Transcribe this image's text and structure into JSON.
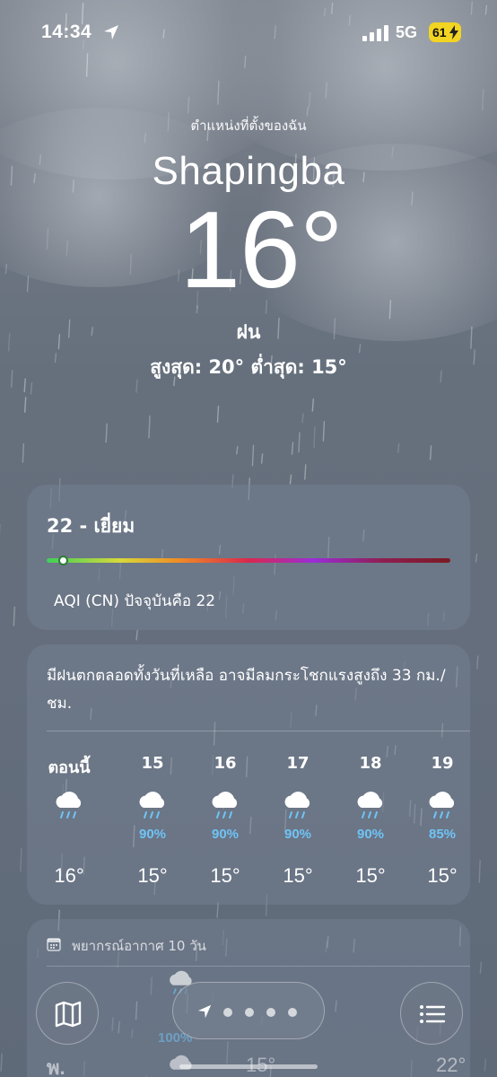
{
  "status_bar": {
    "time": "14:34",
    "network": "5G",
    "battery": "61"
  },
  "hero": {
    "location_label": "ตำแหน่งที่ตั้งของฉัน",
    "city": "Shapingba",
    "temperature": "16°",
    "condition": "ฝน",
    "high_low": "สูงสุด: 20°  ต่ำสุด: 15°"
  },
  "aqi": {
    "value_label": "22 - เยี่ยม",
    "description": "AQI (CN) ปัจจุบันคือ 22",
    "level_fraction": 0.04
  },
  "hourly": {
    "summary": "มีฝนตกตลอดทั้งวันที่เหลือ อาจมีลมกระโชกแรงสูงถึง 33 กม./ชม.",
    "items": [
      {
        "hour": "ตอนนี้",
        "icon": "rain-cloud-icon",
        "precip": "",
        "temp": "16°"
      },
      {
        "hour": "15",
        "icon": "rain-cloud-icon",
        "precip": "90%",
        "temp": "15°"
      },
      {
        "hour": "16",
        "icon": "rain-cloud-icon",
        "precip": "90%",
        "temp": "15°"
      },
      {
        "hour": "17",
        "icon": "rain-cloud-icon",
        "precip": "90%",
        "temp": "15°"
      },
      {
        "hour": "18",
        "icon": "rain-cloud-icon",
        "precip": "90%",
        "temp": "15°"
      },
      {
        "hour": "19",
        "icon": "rain-cloud-icon",
        "precip": "85%",
        "temp": "15°"
      }
    ]
  },
  "daily": {
    "header": "พยากรณ์อากาศ 10 วัน",
    "row1_precip": "100%",
    "row2_day": "พ.",
    "row2_low": "15°",
    "row2_high": "22°"
  },
  "colors": {
    "precip_blue": "#6fc3f5",
    "battery_yellow": "#f2d422"
  }
}
